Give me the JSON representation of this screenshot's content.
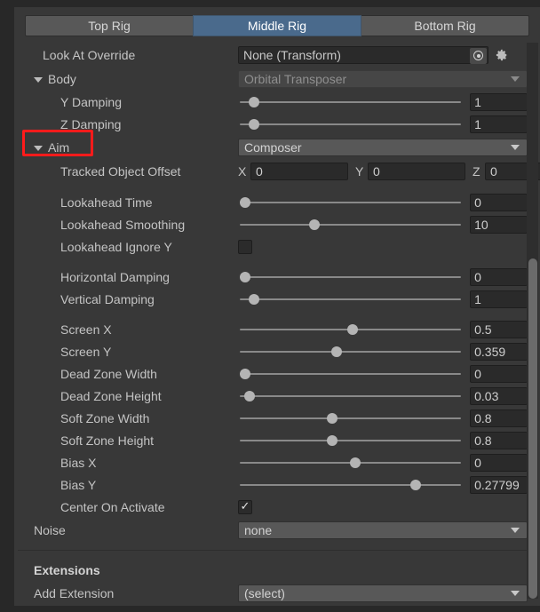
{
  "tabs": [
    {
      "label": "Top Rig",
      "active": false
    },
    {
      "label": "Middle Rig",
      "active": true
    },
    {
      "label": "Bottom Rig",
      "active": false
    }
  ],
  "look_at_override": {
    "label": "Look At Override",
    "value": "None (Transform)",
    "picker_icon": "target-circle-icon",
    "settings_icon": "gear-icon"
  },
  "body": {
    "label": "Body",
    "value": "Orbital Transposer",
    "disabled": true,
    "expanded": true,
    "rows": [
      {
        "label": "Y Damping",
        "value": "1",
        "knob_pct": 7
      },
      {
        "label": "Z Damping",
        "value": "1",
        "knob_pct": 7
      }
    ]
  },
  "aim": {
    "label": "Aim",
    "value": "Composer",
    "expanded": true,
    "highlighted": true,
    "tracked_object_offset": {
      "label": "Tracked Object Offset",
      "x_axis": "X",
      "x": "0",
      "y_axis": "Y",
      "y": "0",
      "z_axis": "Z",
      "z": "0"
    },
    "lookahead": [
      {
        "label": "Lookahead Time",
        "value": "0",
        "knob_pct": 3
      },
      {
        "label": "Lookahead Smoothing",
        "value": "10",
        "knob_pct": 34
      }
    ],
    "lookahead_ignore_y": {
      "label": "Lookahead Ignore Y",
      "checked": false
    },
    "damping": [
      {
        "label": "Horizontal Damping",
        "value": "0",
        "knob_pct": 3
      },
      {
        "label": "Vertical Damping",
        "value": "1",
        "knob_pct": 7
      }
    ],
    "screen": [
      {
        "label": "Screen X",
        "value": "0.5",
        "knob_pct": 51
      },
      {
        "label": "Screen Y",
        "value": "0.359",
        "knob_pct": 44
      },
      {
        "label": "Dead Zone Width",
        "value": "0",
        "knob_pct": 3
      },
      {
        "label": "Dead Zone Height",
        "value": "0.03",
        "knob_pct": 5
      },
      {
        "label": "Soft Zone Width",
        "value": "0.8",
        "knob_pct": 42
      },
      {
        "label": "Soft Zone Height",
        "value": "0.8",
        "knob_pct": 42
      },
      {
        "label": "Bias X",
        "value": "0",
        "knob_pct": 52
      },
      {
        "label": "Bias Y",
        "value": "0.27799",
        "knob_pct": 79
      }
    ],
    "center_on_activate": {
      "label": "Center On Activate",
      "checked": true
    }
  },
  "noise": {
    "label": "Noise",
    "value": "none"
  },
  "extensions": {
    "title": "Extensions",
    "add_label": "Add Extension",
    "add_value": "(select)"
  },
  "colors": {
    "accent": "#4a6a8c",
    "highlight": "#ff1b1b",
    "panel_bg": "#383838",
    "field_bg": "#2a2a2a"
  }
}
